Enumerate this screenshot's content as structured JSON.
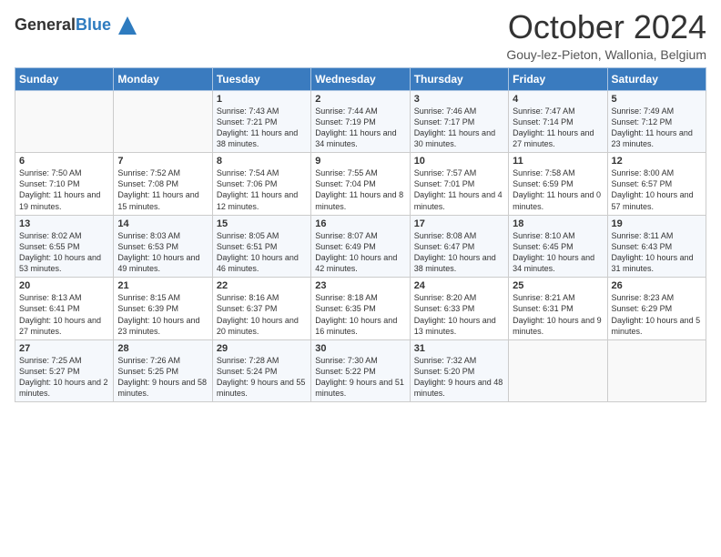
{
  "header": {
    "logo_general": "General",
    "logo_blue": "Blue",
    "month_title": "October 2024",
    "subtitle": "Gouy-lez-Pieton, Wallonia, Belgium"
  },
  "weekdays": [
    "Sunday",
    "Monday",
    "Tuesday",
    "Wednesday",
    "Thursday",
    "Friday",
    "Saturday"
  ],
  "weeks": [
    [
      {
        "day": "",
        "info": ""
      },
      {
        "day": "",
        "info": ""
      },
      {
        "day": "1",
        "info": "Sunrise: 7:43 AM\nSunset: 7:21 PM\nDaylight: 11 hours and 38 minutes."
      },
      {
        "day": "2",
        "info": "Sunrise: 7:44 AM\nSunset: 7:19 PM\nDaylight: 11 hours and 34 minutes."
      },
      {
        "day": "3",
        "info": "Sunrise: 7:46 AM\nSunset: 7:17 PM\nDaylight: 11 hours and 30 minutes."
      },
      {
        "day": "4",
        "info": "Sunrise: 7:47 AM\nSunset: 7:14 PM\nDaylight: 11 hours and 27 minutes."
      },
      {
        "day": "5",
        "info": "Sunrise: 7:49 AM\nSunset: 7:12 PM\nDaylight: 11 hours and 23 minutes."
      }
    ],
    [
      {
        "day": "6",
        "info": "Sunrise: 7:50 AM\nSunset: 7:10 PM\nDaylight: 11 hours and 19 minutes."
      },
      {
        "day": "7",
        "info": "Sunrise: 7:52 AM\nSunset: 7:08 PM\nDaylight: 11 hours and 15 minutes."
      },
      {
        "day": "8",
        "info": "Sunrise: 7:54 AM\nSunset: 7:06 PM\nDaylight: 11 hours and 12 minutes."
      },
      {
        "day": "9",
        "info": "Sunrise: 7:55 AM\nSunset: 7:04 PM\nDaylight: 11 hours and 8 minutes."
      },
      {
        "day": "10",
        "info": "Sunrise: 7:57 AM\nSunset: 7:01 PM\nDaylight: 11 hours and 4 minutes."
      },
      {
        "day": "11",
        "info": "Sunrise: 7:58 AM\nSunset: 6:59 PM\nDaylight: 11 hours and 0 minutes."
      },
      {
        "day": "12",
        "info": "Sunrise: 8:00 AM\nSunset: 6:57 PM\nDaylight: 10 hours and 57 minutes."
      }
    ],
    [
      {
        "day": "13",
        "info": "Sunrise: 8:02 AM\nSunset: 6:55 PM\nDaylight: 10 hours and 53 minutes."
      },
      {
        "day": "14",
        "info": "Sunrise: 8:03 AM\nSunset: 6:53 PM\nDaylight: 10 hours and 49 minutes."
      },
      {
        "day": "15",
        "info": "Sunrise: 8:05 AM\nSunset: 6:51 PM\nDaylight: 10 hours and 46 minutes."
      },
      {
        "day": "16",
        "info": "Sunrise: 8:07 AM\nSunset: 6:49 PM\nDaylight: 10 hours and 42 minutes."
      },
      {
        "day": "17",
        "info": "Sunrise: 8:08 AM\nSunset: 6:47 PM\nDaylight: 10 hours and 38 minutes."
      },
      {
        "day": "18",
        "info": "Sunrise: 8:10 AM\nSunset: 6:45 PM\nDaylight: 10 hours and 34 minutes."
      },
      {
        "day": "19",
        "info": "Sunrise: 8:11 AM\nSunset: 6:43 PM\nDaylight: 10 hours and 31 minutes."
      }
    ],
    [
      {
        "day": "20",
        "info": "Sunrise: 8:13 AM\nSunset: 6:41 PM\nDaylight: 10 hours and 27 minutes."
      },
      {
        "day": "21",
        "info": "Sunrise: 8:15 AM\nSunset: 6:39 PM\nDaylight: 10 hours and 23 minutes."
      },
      {
        "day": "22",
        "info": "Sunrise: 8:16 AM\nSunset: 6:37 PM\nDaylight: 10 hours and 20 minutes."
      },
      {
        "day": "23",
        "info": "Sunrise: 8:18 AM\nSunset: 6:35 PM\nDaylight: 10 hours and 16 minutes."
      },
      {
        "day": "24",
        "info": "Sunrise: 8:20 AM\nSunset: 6:33 PM\nDaylight: 10 hours and 13 minutes."
      },
      {
        "day": "25",
        "info": "Sunrise: 8:21 AM\nSunset: 6:31 PM\nDaylight: 10 hours and 9 minutes."
      },
      {
        "day": "26",
        "info": "Sunrise: 8:23 AM\nSunset: 6:29 PM\nDaylight: 10 hours and 5 minutes."
      }
    ],
    [
      {
        "day": "27",
        "info": "Sunrise: 7:25 AM\nSunset: 5:27 PM\nDaylight: 10 hours and 2 minutes."
      },
      {
        "day": "28",
        "info": "Sunrise: 7:26 AM\nSunset: 5:25 PM\nDaylight: 9 hours and 58 minutes."
      },
      {
        "day": "29",
        "info": "Sunrise: 7:28 AM\nSunset: 5:24 PM\nDaylight: 9 hours and 55 minutes."
      },
      {
        "day": "30",
        "info": "Sunrise: 7:30 AM\nSunset: 5:22 PM\nDaylight: 9 hours and 51 minutes."
      },
      {
        "day": "31",
        "info": "Sunrise: 7:32 AM\nSunset: 5:20 PM\nDaylight: 9 hours and 48 minutes."
      },
      {
        "day": "",
        "info": ""
      },
      {
        "day": "",
        "info": ""
      }
    ]
  ]
}
